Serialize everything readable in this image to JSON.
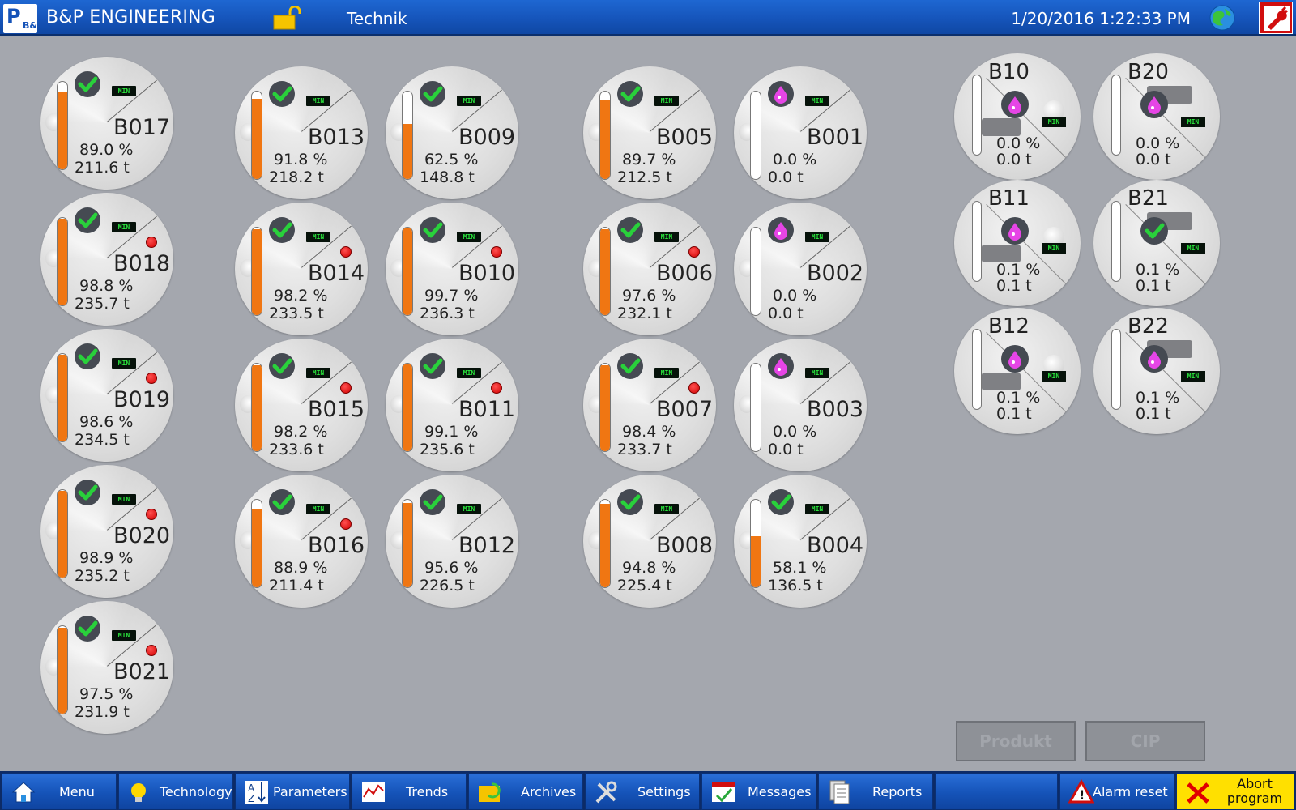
{
  "header": {
    "logo_text": "P",
    "logo_sub": "B&",
    "app_title": "B&P ENGINEERING",
    "mode": "Technik",
    "datetime": "1/20/2016 1:22:33 PM"
  },
  "min_label": "MIN",
  "tanks": [
    {
      "name": "B017",
      "pct_text": "89.0 %",
      "ton": "211.6 t",
      "level": 0.89,
      "status": "ok",
      "alarm": false
    },
    {
      "name": "B018",
      "pct_text": "98.8 %",
      "ton": "235.7 t",
      "level": 0.988,
      "status": "ok",
      "alarm": true
    },
    {
      "name": "B019",
      "pct_text": "98.6 %",
      "ton": "234.5 t",
      "level": 0.986,
      "status": "ok",
      "alarm": true
    },
    {
      "name": "B020",
      "pct_text": "98.9 %",
      "ton": "235.2 t",
      "level": 0.989,
      "status": "ok",
      "alarm": true
    },
    {
      "name": "B021",
      "pct_text": "97.5 %",
      "ton": "231.9 t",
      "level": 0.975,
      "status": "ok",
      "alarm": true
    },
    {
      "name": "B013",
      "pct_text": "91.8 %",
      "ton": "218.2 t",
      "level": 0.918,
      "status": "ok",
      "alarm": false
    },
    {
      "name": "B014",
      "pct_text": "98.2 %",
      "ton": "233.5 t",
      "level": 0.982,
      "status": "ok",
      "alarm": true
    },
    {
      "name": "B015",
      "pct_text": "98.2 %",
      "ton": "233.6 t",
      "level": 0.982,
      "status": "ok",
      "alarm": true
    },
    {
      "name": "B016",
      "pct_text": "88.9 %",
      "ton": "211.4 t",
      "level": 0.889,
      "status": "ok",
      "alarm": true
    },
    {
      "name": "B009",
      "pct_text": "62.5 %",
      "ton": "148.8 t",
      "level": 0.625,
      "status": "ok",
      "alarm": false
    },
    {
      "name": "B010",
      "pct_text": "99.7 %",
      "ton": "236.3 t",
      "level": 0.997,
      "status": "ok",
      "alarm": true
    },
    {
      "name": "B011",
      "pct_text": "99.1 %",
      "ton": "235.6 t",
      "level": 0.991,
      "status": "ok",
      "alarm": true
    },
    {
      "name": "B012",
      "pct_text": "95.6 %",
      "ton": "226.5 t",
      "level": 0.956,
      "status": "ok",
      "alarm": false
    },
    {
      "name": "B005",
      "pct_text": "89.7 %",
      "ton": "212.5 t",
      "level": 0.897,
      "status": "ok",
      "alarm": false
    },
    {
      "name": "B006",
      "pct_text": "97.6 %",
      "ton": "232.1 t",
      "level": 0.976,
      "status": "ok",
      "alarm": true
    },
    {
      "name": "B007",
      "pct_text": "98.4 %",
      "ton": "233.7 t",
      "level": 0.984,
      "status": "ok",
      "alarm": true
    },
    {
      "name": "B008",
      "pct_text": "94.8 %",
      "ton": "225.4 t",
      "level": 0.948,
      "status": "ok",
      "alarm": false
    },
    {
      "name": "B001",
      "pct_text": "0.0 %",
      "ton": "0.0 t",
      "level": 0,
      "status": "drop",
      "alarm": false
    },
    {
      "name": "B002",
      "pct_text": "0.0 %",
      "ton": "0.0 t",
      "level": 0,
      "status": "drop",
      "alarm": false
    },
    {
      "name": "B003",
      "pct_text": "0.0 %",
      "ton": "0.0 t",
      "level": 0,
      "status": "drop",
      "alarm": false
    },
    {
      "name": "B004",
      "pct_text": "58.1 %",
      "ton": "136.5 t",
      "level": 0.581,
      "status": "ok",
      "alarm": false
    }
  ],
  "silos": [
    {
      "name": "B10",
      "pct_text": "0.0 %",
      "ton": "0.0 t",
      "status": "drop",
      "variant": "a"
    },
    {
      "name": "B11",
      "pct_text": "0.1 %",
      "ton": "0.1 t",
      "status": "drop",
      "variant": "a"
    },
    {
      "name": "B12",
      "pct_text": "0.1 %",
      "ton": "0.1 t",
      "status": "drop",
      "variant": "a"
    },
    {
      "name": "B20",
      "pct_text": "0.0 %",
      "ton": "0.0 t",
      "status": "drop",
      "variant": "b"
    },
    {
      "name": "B21",
      "pct_text": "0.1 %",
      "ton": "0.1 t",
      "status": "ok",
      "variant": "b"
    },
    {
      "name": "B22",
      "pct_text": "0.1 %",
      "ton": "0.1 t",
      "status": "drop",
      "variant": "b"
    }
  ],
  "actions": {
    "produkt": "Produkt",
    "cip": "CIP"
  },
  "footer": {
    "menu": "Menu",
    "technology": "Technology",
    "parameters": "Parameters",
    "trends": "Trends",
    "archives": "Archives",
    "settings": "Settings",
    "messages": "Messages",
    "reports": "Reports",
    "alarm_reset": "Alarm reset",
    "abort_line1": "Abort",
    "abort_line2": "program"
  },
  "colors": {
    "fill": "#f07612",
    "check": "#29d13b",
    "drop": "#e645e6",
    "header": "#1553b8",
    "abort": "#ffe000"
  },
  "icons": {
    "lock": "lock-open-icon",
    "globe": "globe-icon",
    "tool": "wrench-icon"
  }
}
